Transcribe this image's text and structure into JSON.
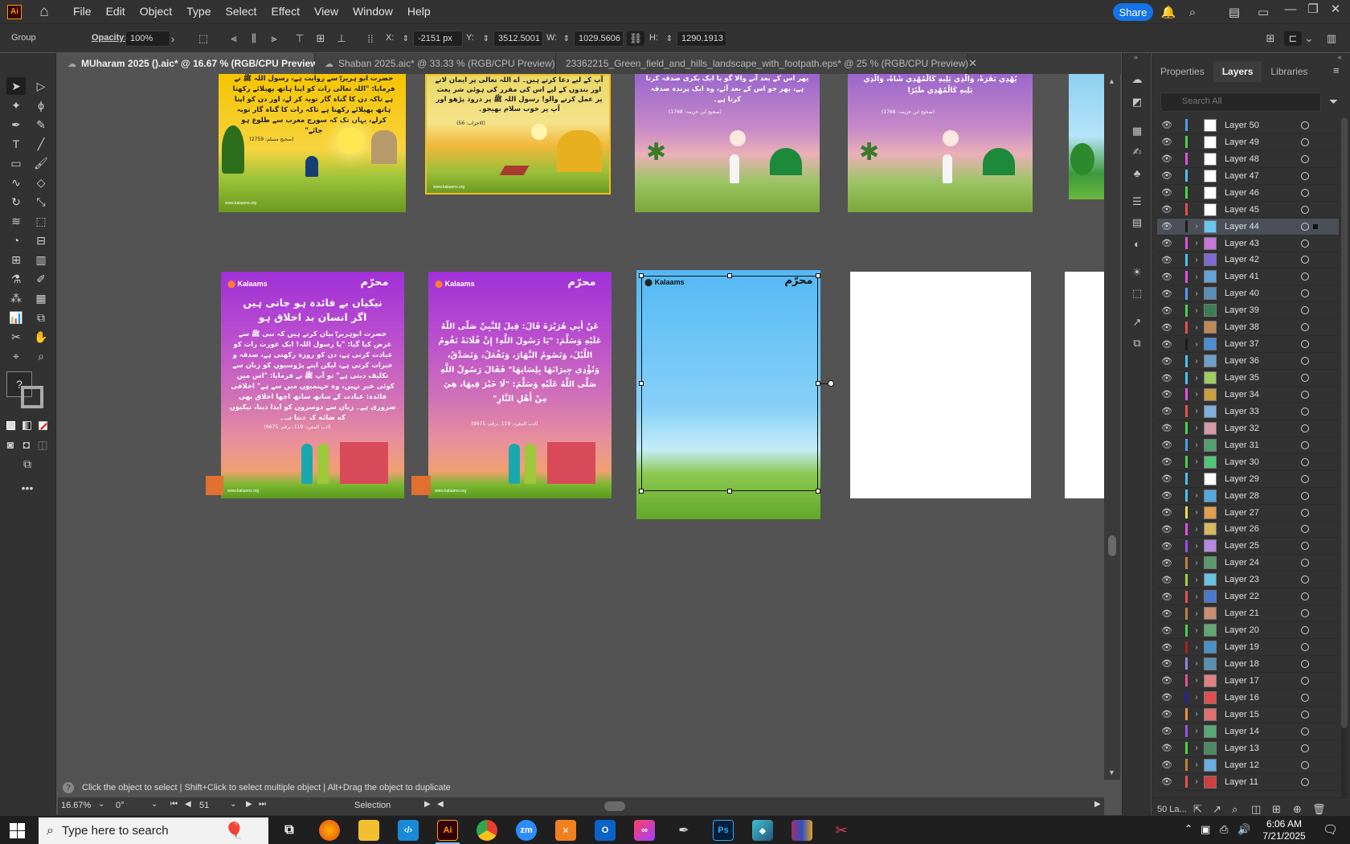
{
  "app": {
    "logo": "Ai",
    "menus": [
      "File",
      "Edit",
      "Object",
      "Type",
      "Select",
      "Effect",
      "View",
      "Window",
      "Help"
    ],
    "share_label": "Share"
  },
  "control": {
    "selection_type": "Group",
    "opacity_label": "Opacity:",
    "opacity_value": "100%",
    "x_label": "X:",
    "x_value": "-2151 px",
    "y_label": "Y:",
    "y_value": "3512.5001 p",
    "w_label": "W:",
    "w_value": "1029.5606 p",
    "h_label": "H:",
    "h_value": "1290.1913 p"
  },
  "tabs": [
    {
      "title": "MUharam 2025 ().aic* @ 16.67 % (RGB/CPU Preview)",
      "active": true
    },
    {
      "title": "Shaban 2025.aic* @ 33.33 % (RGB/CPU Preview)",
      "active": false
    },
    {
      "title": "23362215_Green_field_and_hills_landscape_with_footpath.eps* @ 25 % (RGB/CPU Preview)",
      "active": false
    }
  ],
  "toolbar": {
    "help_glyph": "?"
  },
  "artboards": {
    "brand": "Kalaams",
    "muharram_title": "محرّم",
    "a1": {
      "text": "حضرت ابو ہریرہؓ سے روایت ہے، رسول اللہ ﷺ نے فرمایا: \"اللہ تعالی رات کو اپنا ہاتھ پھیلائے رکھتا ہے تاکہ دن کا گناہ گار توبہ کر لے، اور دن کو اپنا ہاتھ پھیلائے رکھتا ہے تاکہ رات کا گناہ گار توبہ کرلے، یہاں تک کہ سورج مغرب سے طلوع ہو جائے\"",
      "ref": "(صحیح مسلم: 2759)",
      "site": "www.kalaams.org"
    },
    "a2": {
      "text": "آپ کے لیے دعا کرتے ہیں۔ اے اللہ تعالی پر ایمان لانے اور بندوں کے لیے اس کی مقرر کی ہوئی شر یعت پر عمل کرنے والو! رسول اللہ ﷺ پر درود پڑھو اور آپ پر خوب سلام بھیجو۔",
      "ref": "(الاحزاب: 56)",
      "site": "www.kalaams.org"
    },
    "a3": {
      "text": "پھر اس کے بعد آنے والا گو یا ایک بکری صدقہ کرتا ہے، پھر جو اس کے بعد آئے، وہ ایک پرندہ صدقہ کرتا ہے۔",
      "ref": "(صحیح ابن خزیمہ: 1768)",
      "site": "www.kalaams.org"
    },
    "a4": {
      "text": "يُهْدِي بَقَرَةً، وَالَّذِي يَلِيهِ كَالْمُهْدِي شَاةً، وَالَّذِي يَلِيهِ كَالْمُهْدِي طَيْرًا",
      "ref": "(صحیح ابن خزیمہ: 1768)",
      "site": "www.kalaams.org"
    },
    "a6": {
      "title": "نیکیاں بے فائدہ ہو جاتی ہیں اگر انسان بد اخلاق ہو",
      "text": "حضرت ابوہریرہؓ بیان کرتے ہیں کہ نبی ﷺ سے عرض کیا گیا: \"یا رسول اللہ! ایک عورت رات کو عبادت کرتی ہے، دن کو روزہ رکھتی ہے، صدقہ و خیرات کرتی ہے، لیکن اپنے پڑوسیوں کو زبان سے تکلیف دیتی ہے\" تو آپ ﷺ نے فرمایا: \"اس میں کوئی خیر نہیں، وہ جہنمیوں میں سے ہے\" اخلاقی فائدہ: عبادت کے ساتھ ساتھ اچھا اخلاق بھی ضروری ہے۔ زبان سے دوسروں کو ایذا دینا، نیکیوں کو ضائع کر دیتا ہے۔",
      "ref": "(ادب المفرد: 119، برقم: 9675)",
      "site": "www.kalaams.org"
    },
    "a7": {
      "text": "عَنْ أَبِي هُرَيْرَةَ قَالَ: قِيلَ لِلنَّبِيِّ صَلَّى اللَّهُ عَلَيْهِ وَسَلَّمَ: \"يَا رَسُولَ اللَّهِ! إِنَّ فُلَانَةً تَقُومُ اللَّيْلَ، وَتَصُومُ النَّهَارَ، وَتَفْعَلُ، وَتَصَدَّقُ، وَتُؤْذِي جِيرَانَهَا بِلِسَانِهَا\" فَقَالَ رَسُولُ اللَّهِ صَلَّى اللَّهُ عَلَيْهِ وَسَلَّمَ: \"لَا خَيْرَ فِيهَا، هِيَ مِنْ أَهْلِ النَّارِ\"",
      "ref": "(ادب المفرد: 119، برقم: 9675)",
      "site": "www.kalaams.org"
    },
    "a8": {
      "brand": "Kalaams"
    }
  },
  "panel": {
    "tabs": [
      "Properties",
      "Layers",
      "Libraries"
    ],
    "active_tab": "Layers",
    "search_placeholder": "Search All",
    "layers": [
      {
        "name": "Layer 50",
        "color": "#4f9dff",
        "expandable": false,
        "thumb": "#ffffff"
      },
      {
        "name": "Layer 49",
        "color": "#4ad24a",
        "expandable": false,
        "thumb": "#ffffff"
      },
      {
        "name": "Layer 48",
        "color": "#e54fe5",
        "expandable": false,
        "thumb": "#ffffff"
      },
      {
        "name": "Layer 47",
        "color": "#4fc0ff",
        "expandable": false,
        "thumb": "#ffffff"
      },
      {
        "name": "Layer 46",
        "color": "#4ad24a",
        "expandable": false,
        "thumb": "#ffffff"
      },
      {
        "name": "Layer 45",
        "color": "#e84f4f",
        "expandable": false,
        "thumb": "#ffffff"
      },
      {
        "name": "Layer 44",
        "color": "#1b1b1b",
        "expandable": true,
        "thumb": "#67c7f0",
        "selected": true
      },
      {
        "name": "Layer 43",
        "color": "#e54fe5",
        "expandable": true,
        "thumb": "#c678d8"
      },
      {
        "name": "Layer 42",
        "color": "#4fc0ff",
        "expandable": true,
        "thumb": "#7d6ad4"
      },
      {
        "name": "Layer 41",
        "color": "#e54fe5",
        "expandable": true,
        "thumb": "#63a3d8"
      },
      {
        "name": "Layer 40",
        "color": "#4f9dff",
        "expandable": true,
        "thumb": "#5a8fb8"
      },
      {
        "name": "Layer 39",
        "color": "#4ad24a",
        "expandable": true,
        "thumb": "#3c7d55"
      },
      {
        "name": "Layer 38",
        "color": "#e84f4f",
        "expandable": true,
        "thumb": "#c08a58"
      },
      {
        "name": "Layer 37",
        "color": "#1b1b1b",
        "expandable": true,
        "thumb": "#4a8fcf"
      },
      {
        "name": "Layer 36",
        "color": "#4fc0ff",
        "expandable": true,
        "thumb": "#6d9fc8"
      },
      {
        "name": "Layer 35",
        "color": "#4fc0ff",
        "expandable": true,
        "thumb": "#a0cc60"
      },
      {
        "name": "Layer 34",
        "color": "#e54fe5",
        "expandable": true,
        "thumb": "#c8a040"
      },
      {
        "name": "Layer 33",
        "color": "#e84f4f",
        "expandable": true,
        "thumb": "#7fb0dc"
      },
      {
        "name": "Layer 32",
        "color": "#4ad24a",
        "expandable": true,
        "thumb": "#d49aa8"
      },
      {
        "name": "Layer 31",
        "color": "#4f9dff",
        "expandable": true,
        "thumb": "#52a070"
      },
      {
        "name": "Layer 30",
        "color": "#4ad24a",
        "expandable": true,
        "thumb": "#54c47a"
      },
      {
        "name": "Layer 29",
        "color": "#4fc0ff",
        "expandable": false,
        "thumb": "#ffffff"
      },
      {
        "name": "Layer 28",
        "color": "#4fc0ff",
        "expandable": true,
        "thumb": "#58a8e0"
      },
      {
        "name": "Layer 27",
        "color": "#f0e04f",
        "expandable": true,
        "thumb": "#e0a050"
      },
      {
        "name": "Layer 26",
        "color": "#e54fe5",
        "expandable": true,
        "thumb": "#d8b860"
      },
      {
        "name": "Layer 25",
        "color": "#9a4fe5",
        "expandable": true,
        "thumb": "#b68ae0"
      },
      {
        "name": "Layer 24",
        "color": "#c08040",
        "expandable": true,
        "thumb": "#5a9a6a"
      },
      {
        "name": "Layer 23",
        "color": "#a0d040",
        "expandable": true,
        "thumb": "#6ac0e0"
      },
      {
        "name": "Layer 22",
        "color": "#e84f4f",
        "expandable": true,
        "thumb": "#4a7ad0"
      },
      {
        "name": "Layer 21",
        "color": "#c08040",
        "expandable": true,
        "thumb": "#c89070"
      },
      {
        "name": "Layer 20",
        "color": "#4ad24a",
        "expandable": true,
        "thumb": "#60a870"
      },
      {
        "name": "Layer 19",
        "color": "#b02020",
        "expandable": true,
        "thumb": "#4a90c8"
      },
      {
        "name": "Layer 18",
        "color": "#8a8ae0",
        "expandable": true,
        "thumb": "#5890b8"
      },
      {
        "name": "Layer 17",
        "color": "#e84f9a",
        "expandable": true,
        "thumb": "#e08080"
      },
      {
        "name": "Layer 16",
        "color": "#2020b0",
        "expandable": true,
        "thumb": "#e05050"
      },
      {
        "name": "Layer 15",
        "color": "#f09040",
        "expandable": true,
        "thumb": "#e07070"
      },
      {
        "name": "Layer 14",
        "color": "#9a4fe5",
        "expandable": true,
        "thumb": "#58a878"
      },
      {
        "name": "Layer 13",
        "color": "#4ad24a",
        "expandable": true,
        "thumb": "#4a8a60"
      },
      {
        "name": "Layer 12",
        "color": "#c08040",
        "expandable": true,
        "thumb": "#68b0e0"
      },
      {
        "name": "Layer 11",
        "color": "#e84f4f",
        "expandable": true,
        "thumb": "#d04040"
      }
    ],
    "footer_count": "50 La..."
  },
  "status": {
    "hint": "Click the object to select  |  Shift+Click to select multiple object  |  Alt+Drag the object to duplicate",
    "zoom": "16.67%",
    "rotation": "0°",
    "artboard_index": "51",
    "tool_name": "Selection"
  },
  "taskbar": {
    "search_placeholder": "Type here to search",
    "time": "6:06 AM",
    "date": "7/21/2025"
  }
}
